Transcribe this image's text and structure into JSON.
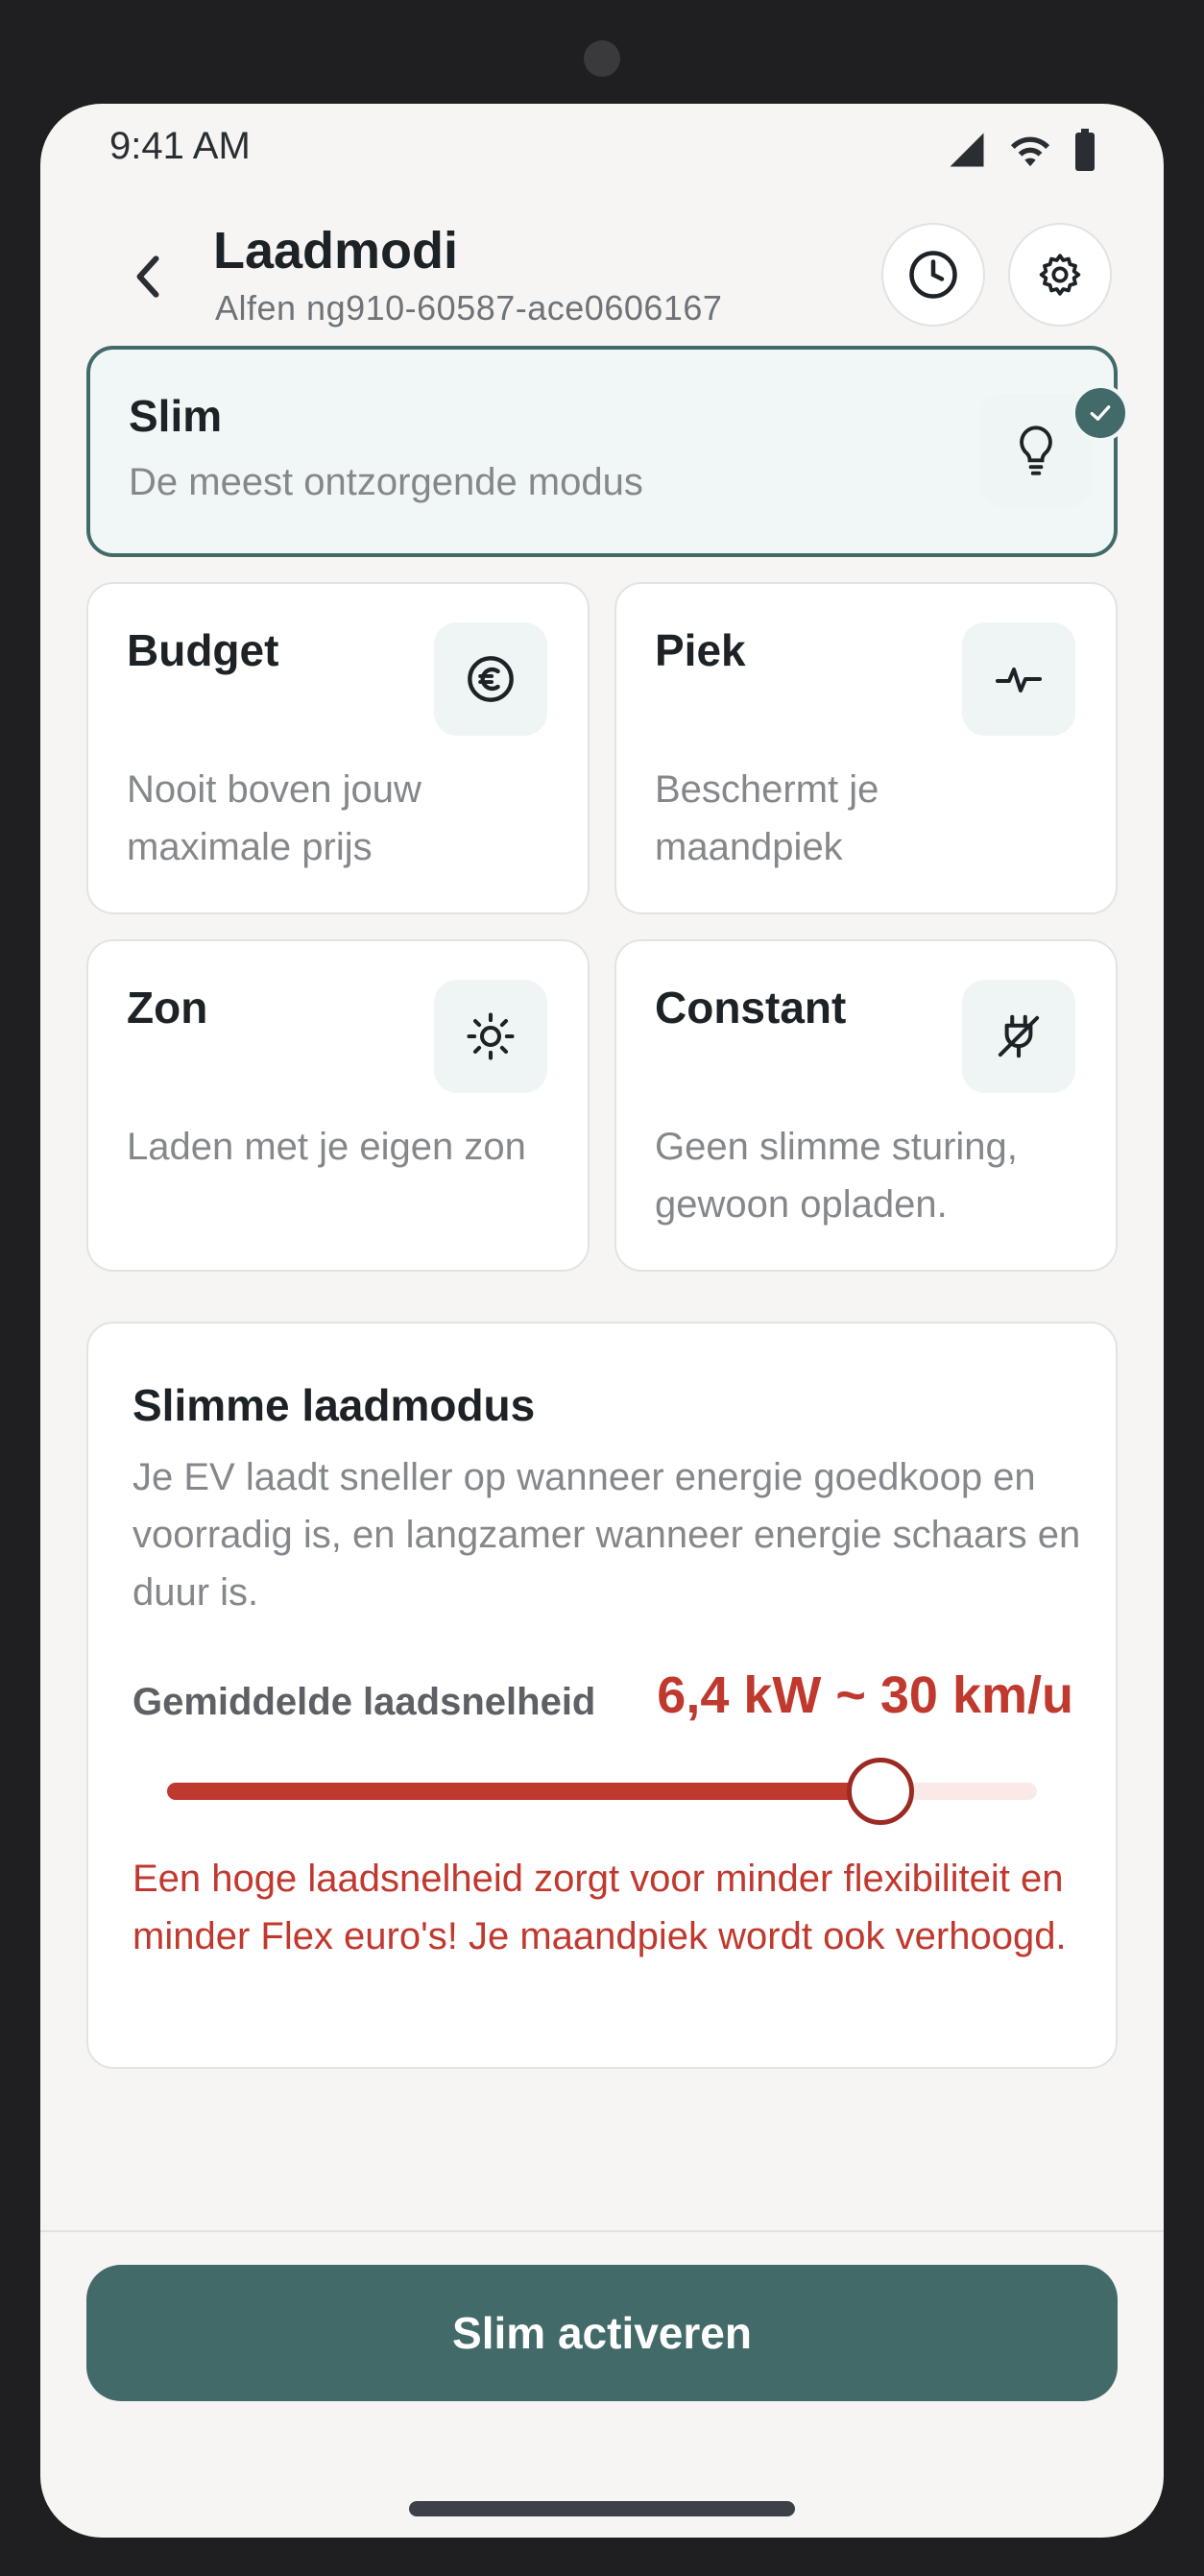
{
  "status_bar": {
    "time": "9:41 AM"
  },
  "header": {
    "title": "Laadmodi",
    "subtitle": "Alfen ng910-60587-ace0606167"
  },
  "modes": [
    {
      "title": "Slim",
      "description": "De meest ontzorgende modus",
      "icon": "lightbulb-icon",
      "selected": true
    },
    {
      "title": "Budget",
      "description": "Nooit boven jouw maximale prijs",
      "icon": "euro-icon",
      "selected": false
    },
    {
      "title": "Piek",
      "description": "Beschermt je maandpiek",
      "icon": "pulse-icon",
      "selected": false
    },
    {
      "title": "Zon",
      "description": "Laden met je eigen zon",
      "icon": "sun-icon",
      "selected": false
    },
    {
      "title": "Constant",
      "description": "Geen slimme sturing, gewoon opladen.",
      "icon": "plug-off-icon",
      "selected": false
    }
  ],
  "info": {
    "title": "Slimme laadmodus",
    "body": "Je EV laadt sneller op wanneer energie goedkoop en voorradig is, en langzamer wanneer energie schaars en duur is.",
    "speed_label": "Gemiddelde laadsnelheid",
    "speed_value": "6,4 kW ~ 30 km/u",
    "slider_fraction": 0.82,
    "warning": "Een hoge laadsnelheid zorgt voor minder flexibiliteit en minder Flex euro's! Je maandpiek wordt ook verhoogd."
  },
  "activate_label": "Slim activeren",
  "colors": {
    "primary": "#426a69",
    "accent_red": "#c0392f",
    "background": "#f6f5f3"
  }
}
